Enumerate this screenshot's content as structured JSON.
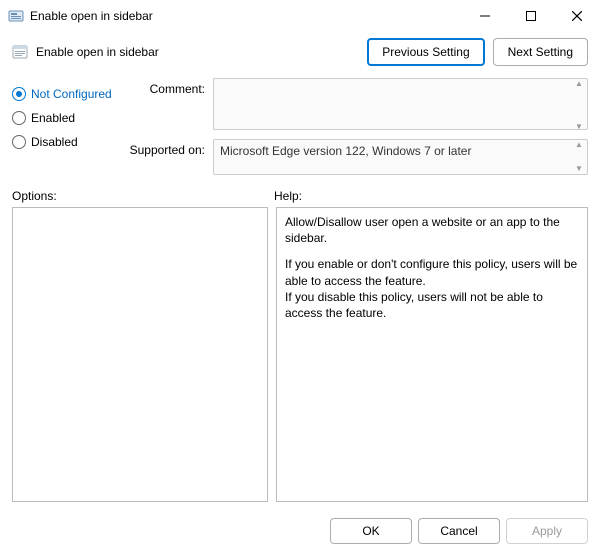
{
  "window": {
    "title": "Enable open in sidebar"
  },
  "header": {
    "title": "Enable open in sidebar",
    "previous_btn": "Previous Setting",
    "next_btn": "Next Setting"
  },
  "radios": {
    "not_configured": "Not Configured",
    "enabled": "Enabled",
    "disabled": "Disabled",
    "selected": "not_configured"
  },
  "fields": {
    "comment_label": "Comment:",
    "comment_value": "",
    "supported_label": "Supported on:",
    "supported_value": "Microsoft Edge version 122, Windows 7 or later"
  },
  "labels": {
    "options": "Options:",
    "help": "Help:"
  },
  "help": {
    "p1": "Allow/Disallow user open a website or an app to the sidebar.",
    "p2": "If you enable or don't configure this policy, users will be able to access the feature.",
    "p3": "If you disable this policy, users will not be able to access the feature."
  },
  "footer": {
    "ok": "OK",
    "cancel": "Cancel",
    "apply": "Apply"
  }
}
